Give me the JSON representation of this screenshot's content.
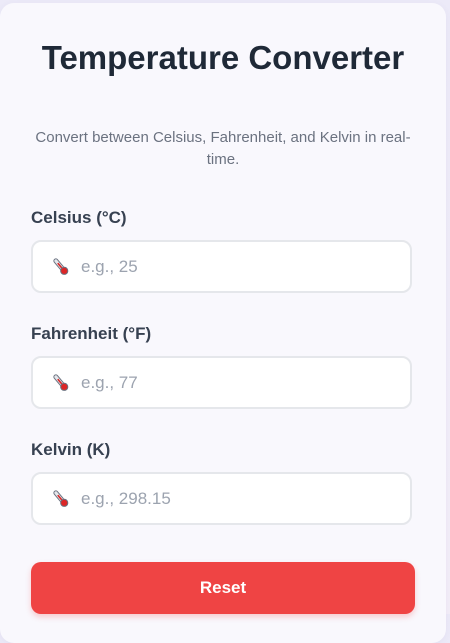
{
  "header": {
    "title": "Temperature Converter",
    "subtitle": "Convert between Celsius, Fahrenheit, and Kelvin in real-time."
  },
  "fields": [
    {
      "label": "Celsius (°C)",
      "icon": "thermometer-icon",
      "value": "",
      "placeholder": "e.g., 25"
    },
    {
      "label": "Fahrenheit (°F)",
      "icon": "thermometer-icon",
      "value": "",
      "placeholder": "e.g., 77"
    },
    {
      "label": "Kelvin (K)",
      "icon": "thermometer-icon",
      "value": "",
      "placeholder": "e.g., 298.15"
    }
  ],
  "actions": {
    "reset_label": "Reset"
  },
  "colors": {
    "accent": "#ef4444",
    "title": "#1f2937",
    "muted": "#6b7280"
  }
}
